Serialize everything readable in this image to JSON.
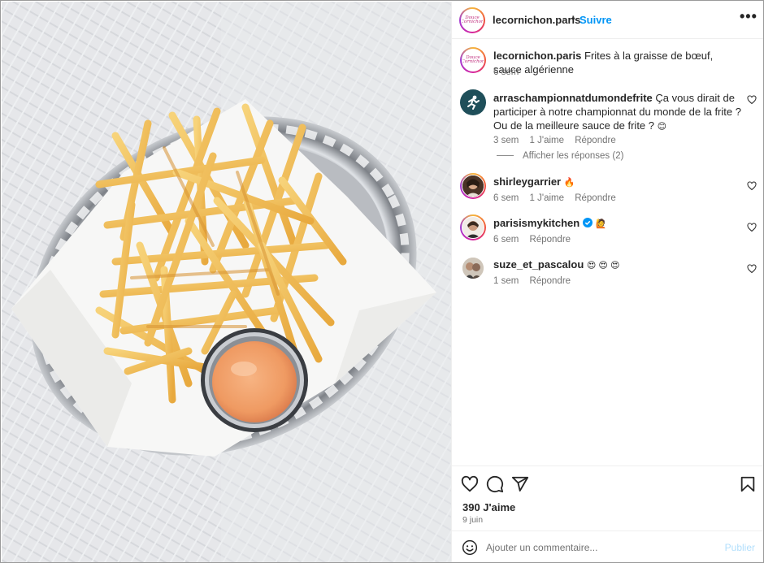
{
  "post": {
    "author": "lecornichon.paris",
    "logo_text": "Douce Cornichon",
    "follow_label": "Suivre",
    "separator": "•",
    "more_label": "•••",
    "caption_text": "Frites à la graisse de bœuf, sauce algérienne",
    "caption_time": "6 sem",
    "likes": "390 J'aime",
    "date": "9 juin"
  },
  "comments": [
    {
      "user": "arraschampionnatdumondefrite",
      "text": "Ça vous dirait de participer à notre championnat du monde de la frite ? Ou de la meilleure sauce de frite ?",
      "emoji": "😊",
      "time": "3 sem",
      "likes": "1 J'aime",
      "reply": "Répondre"
    },
    {
      "user": "shirleygarrier",
      "text": "",
      "emoji": "🔥",
      "time": "6 sem",
      "likes": "1 J'aime",
      "reply": "Répondre"
    },
    {
      "user": "parisismykitchen",
      "text": "",
      "emoji": "🙋",
      "time": "6 sem",
      "likes": "",
      "reply": "Répondre"
    },
    {
      "user": "suze_et_pascalou",
      "text": "",
      "emoji": "😍 😍 😍",
      "time": "1 sem",
      "likes": "",
      "reply": "Répondre"
    }
  ],
  "view_replies": "Afficher les réponses (2)",
  "add_comment": {
    "placeholder": "Ajouter un commentaire...",
    "publish_label": "Publier"
  },
  "colors": {
    "accent": "#0095f6",
    "publish_disabled": "#b2dffc",
    "verified": "#0095f6",
    "muted": "#737373"
  },
  "icons": [
    "heart-icon",
    "comment-icon",
    "share-icon",
    "bookmark-icon",
    "emoji-icon",
    "more-icon",
    "verified-badge-icon"
  ]
}
